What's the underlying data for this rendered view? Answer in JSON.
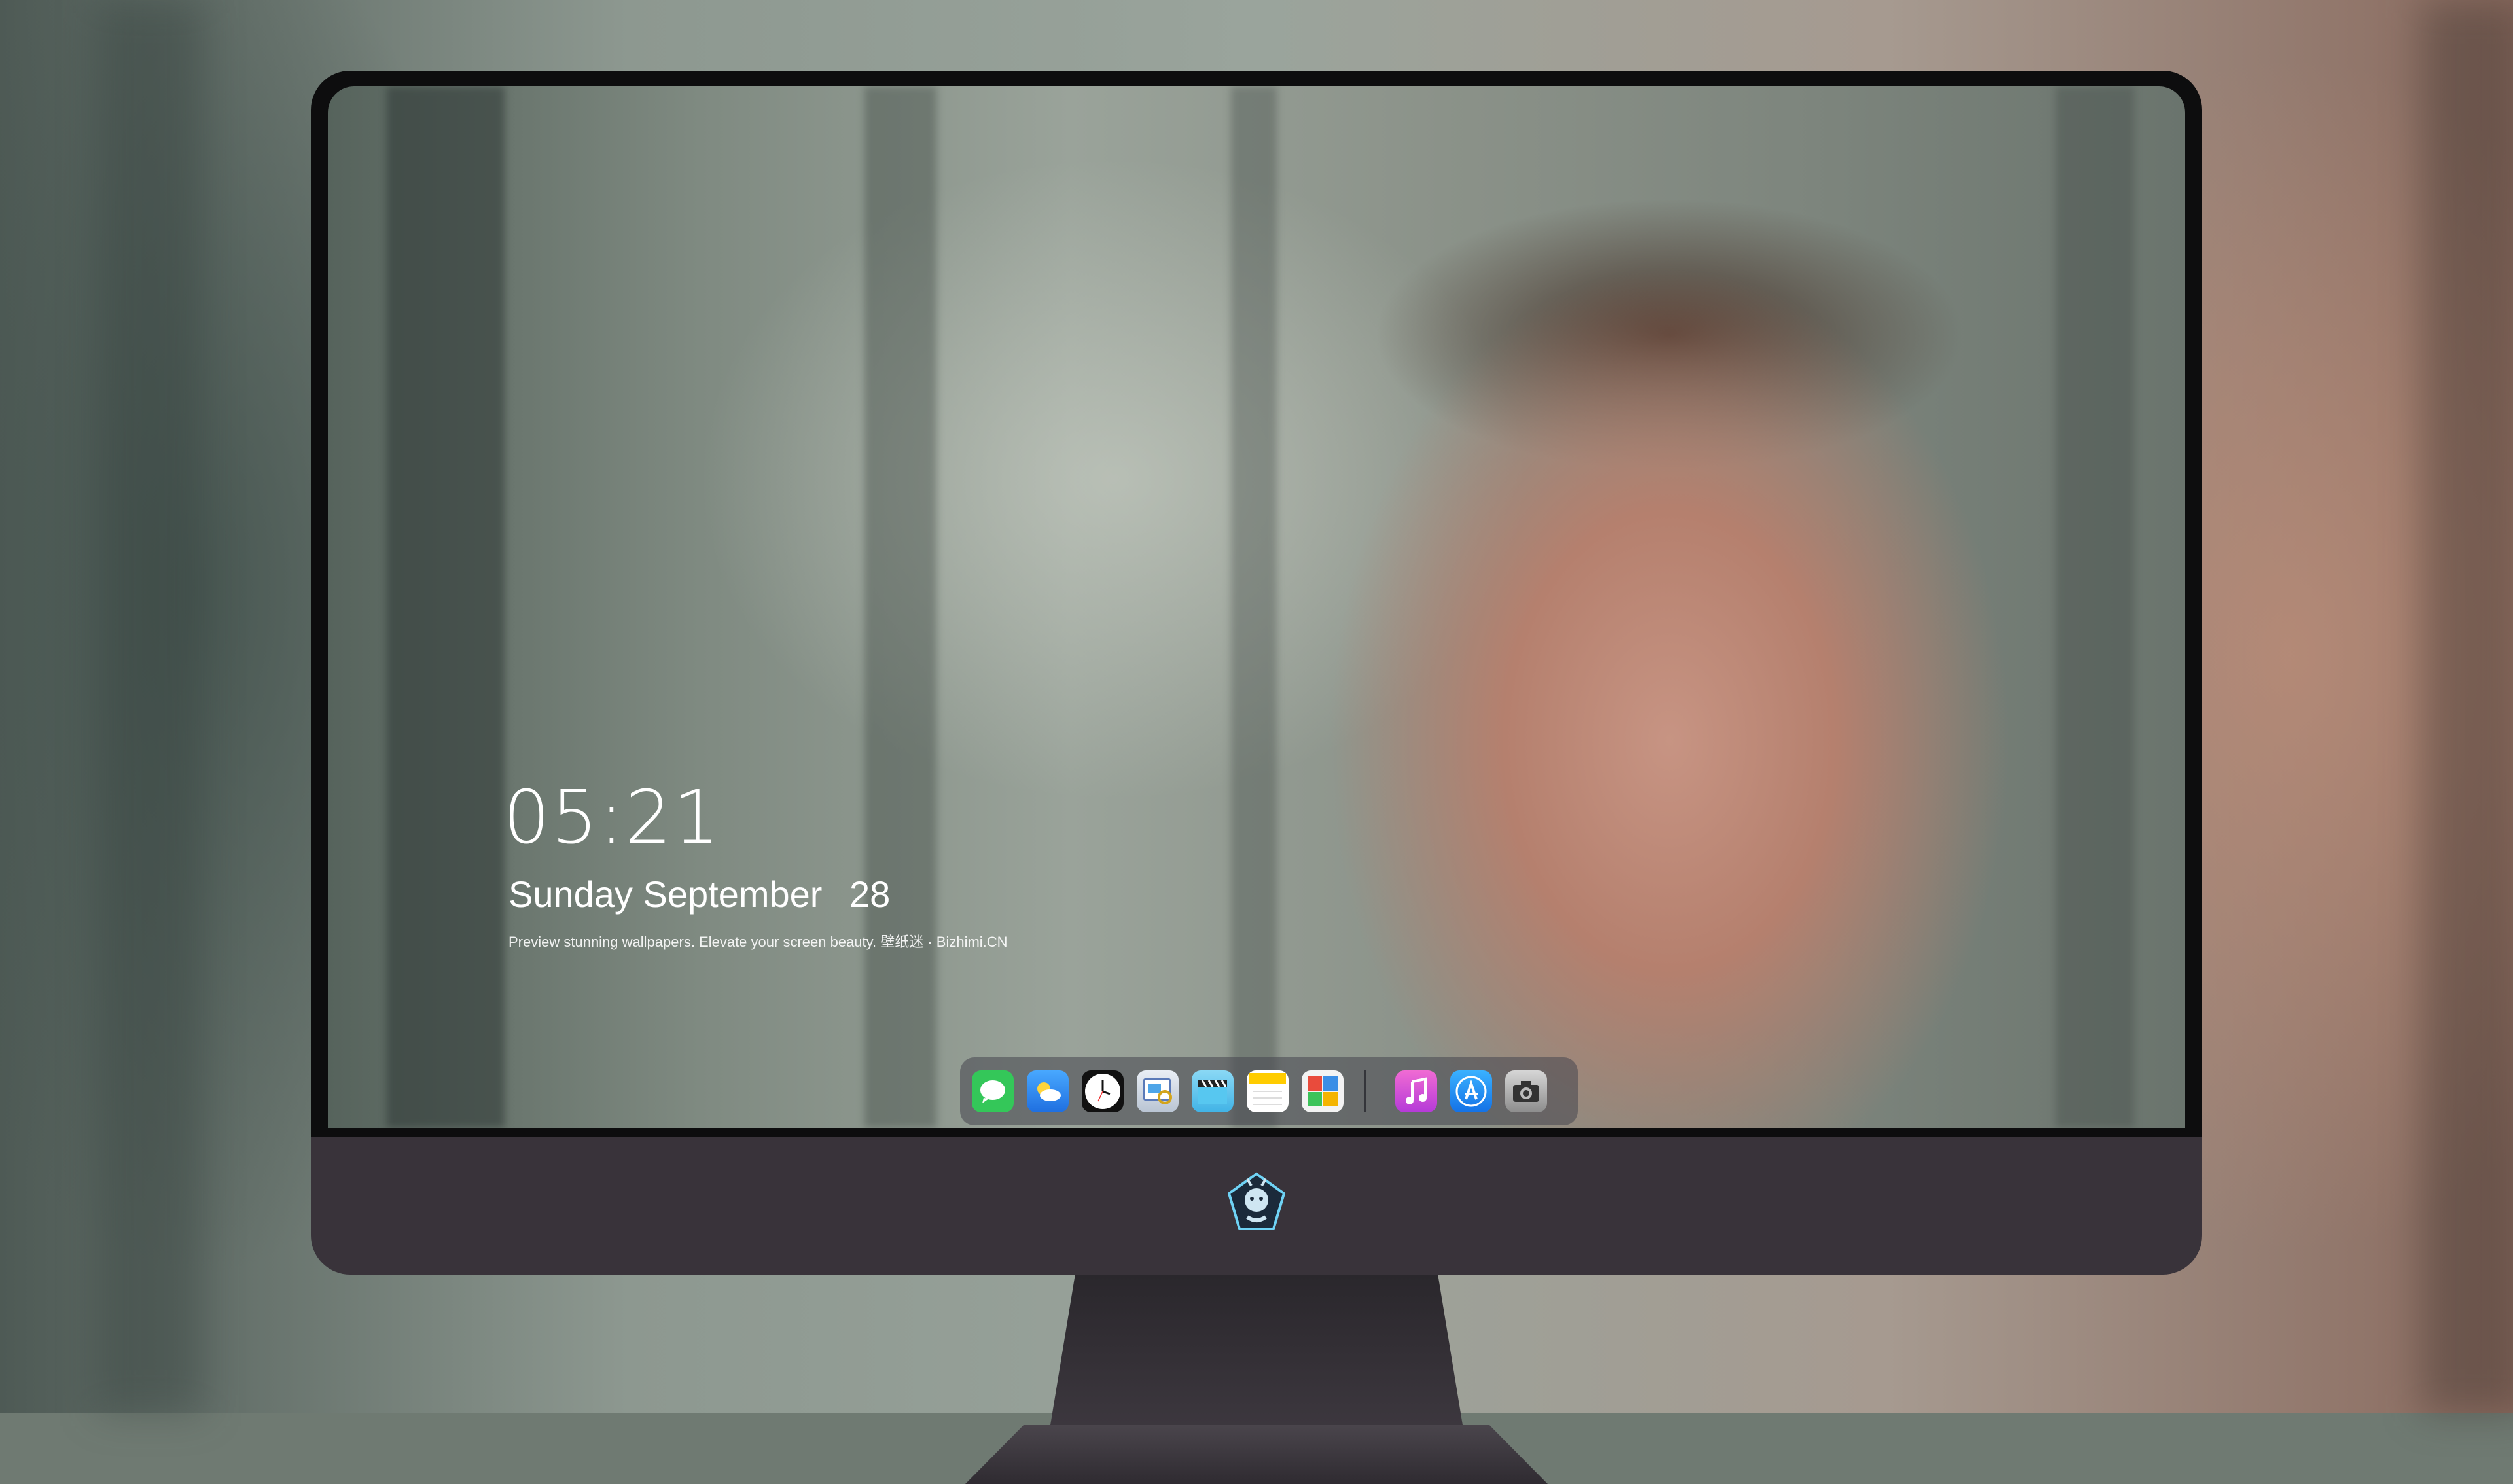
{
  "lock_screen": {
    "time": "05:21",
    "weekday": "Sunday",
    "month": "September",
    "day": "28",
    "caption": "Preview stunning wallpapers. Elevate your screen beauty. 壁纸迷 · Bizhimi.CN"
  },
  "dock": {
    "apps": [
      "messages-icon",
      "weather-icon",
      "clock-icon",
      "preview-icon",
      "clapper-icon",
      "notes-icon",
      "photo-booth-icon"
    ],
    "apps_right": [
      "music-icon",
      "app-store-icon",
      "camera-icon"
    ]
  },
  "colors": {
    "chin": "#39333a",
    "bezel": "#0d0d0e",
    "messages": "#34c759",
    "weather": "#2e86ff",
    "music": "#d54cd6",
    "app_store": "#1a8cff"
  }
}
